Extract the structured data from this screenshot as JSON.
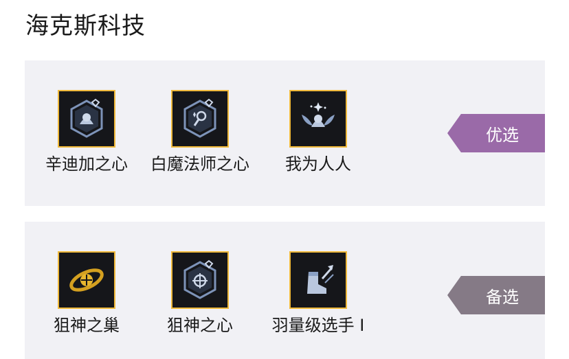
{
  "page": {
    "title": "海克斯科技"
  },
  "groups": [
    {
      "tag_label": "优选",
      "tag_color": "#9a6aa8",
      "items": [
        {
          "label": "辛迪加之心",
          "icon": "syndicate-heart-icon"
        },
        {
          "label": "白魔法师之心",
          "icon": "arcanist-heart-icon"
        },
        {
          "label": "我为人人",
          "icon": "one-for-all-wings-icon"
        }
      ]
    },
    {
      "tag_label": "备选",
      "tag_color": "#857a86",
      "items": [
        {
          "label": "狙神之巢",
          "icon": "sniper-nest-icon"
        },
        {
          "label": "狙神之心",
          "icon": "sniper-heart-icon"
        },
        {
          "label": "羽量级选手 I",
          "icon": "featherweights-boot-icon"
        }
      ]
    }
  ],
  "colors": {
    "icon_border": "#f0b93a",
    "icon_bg": "#15161a",
    "panel_bg": "#f1f1f5"
  }
}
